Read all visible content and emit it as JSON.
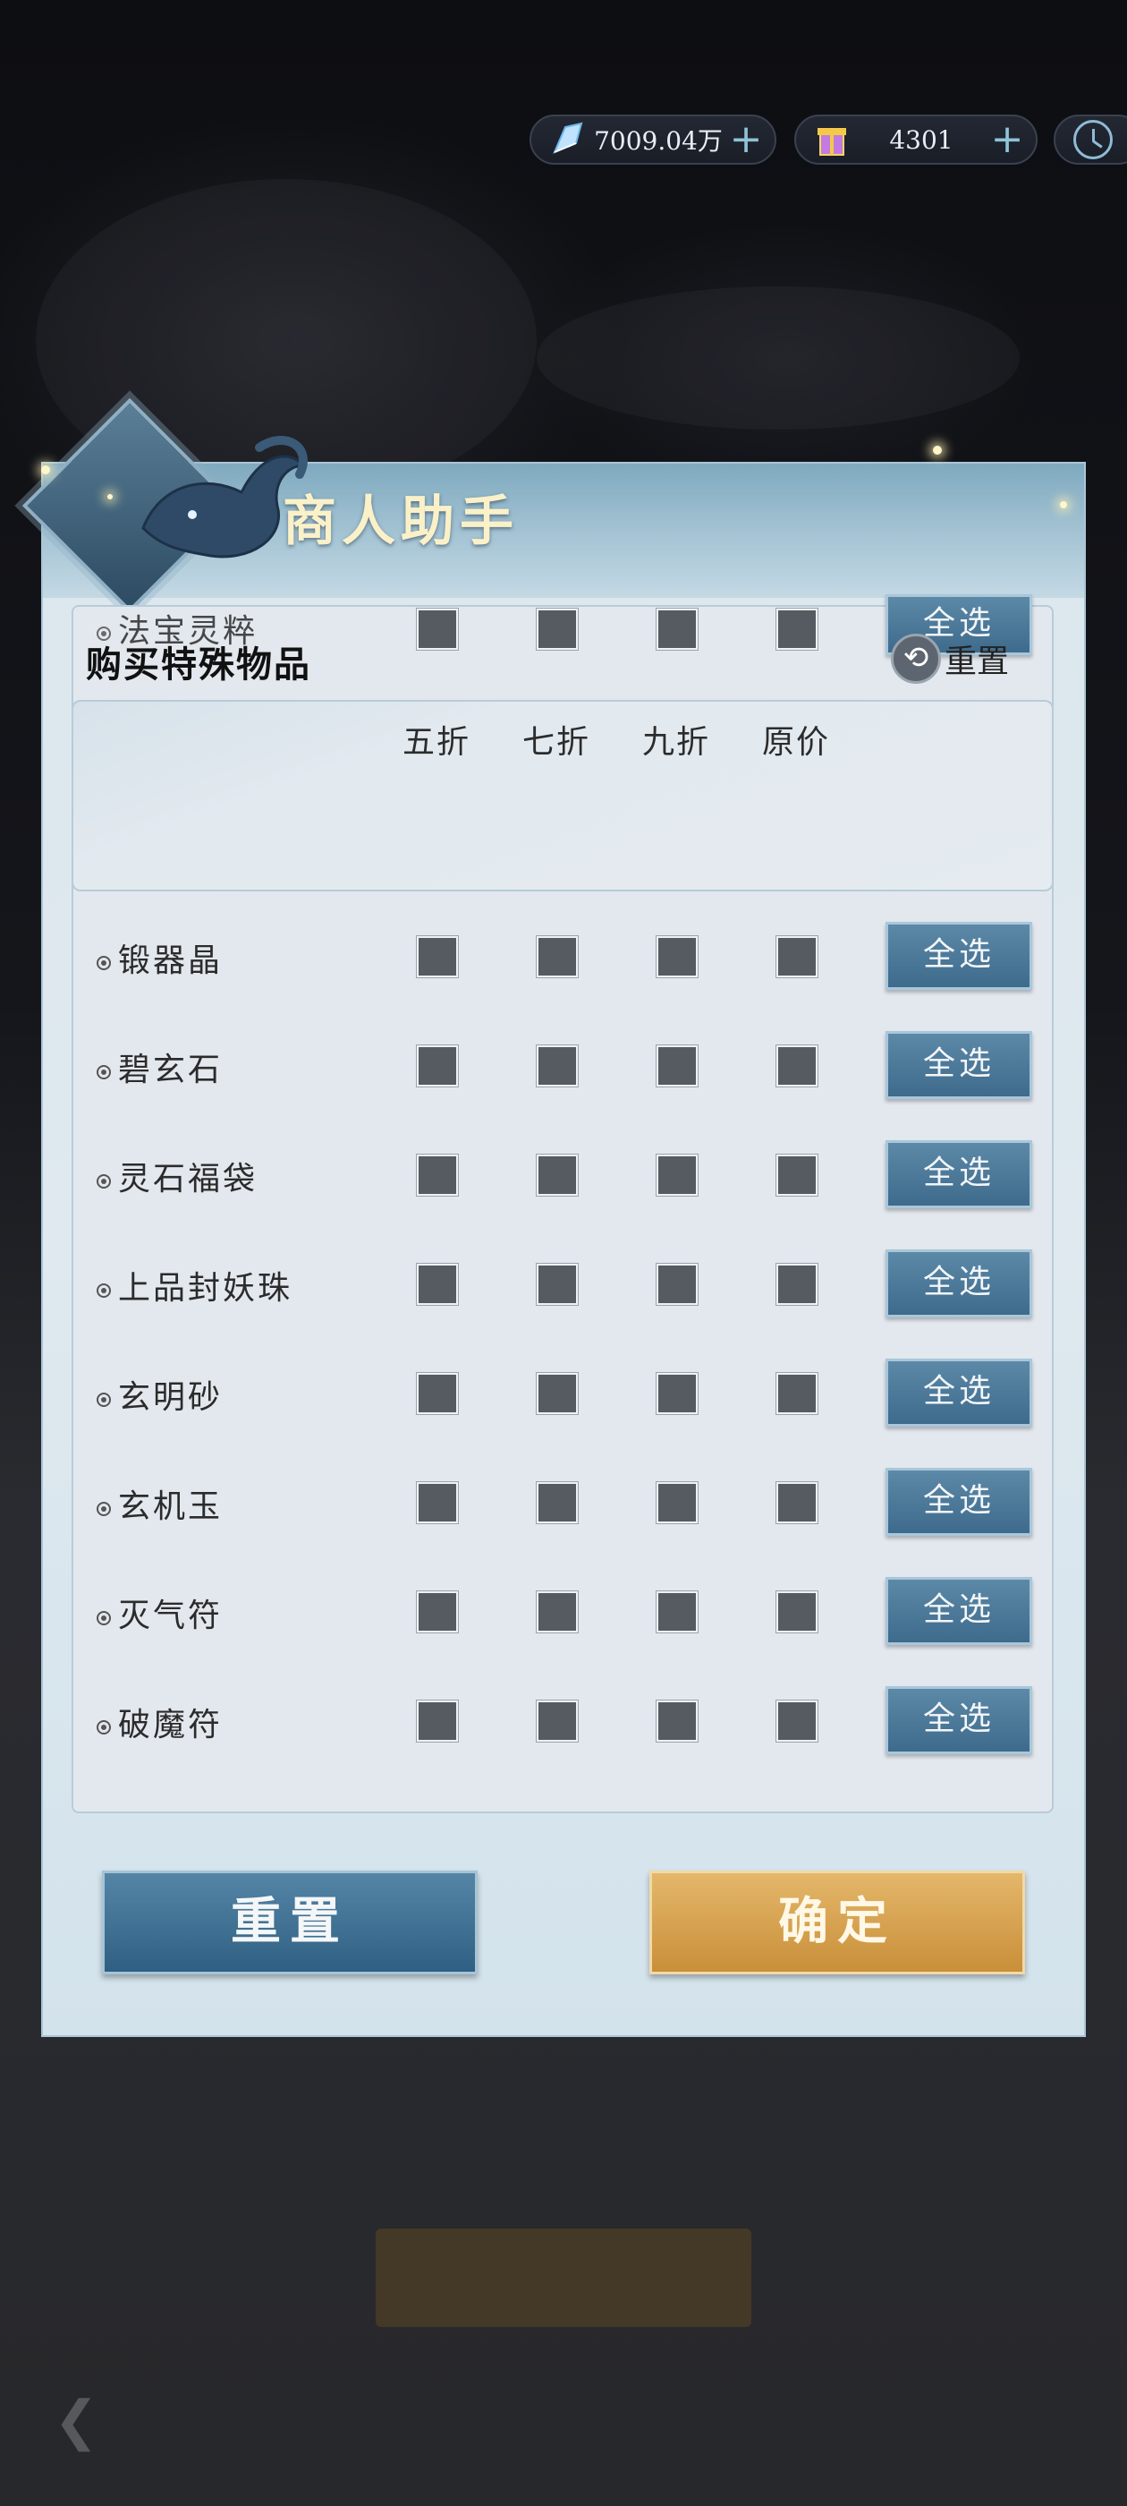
{
  "resources": {
    "spirit_stone": {
      "value": "7009.04万",
      "icon": "crystal-icon"
    },
    "gift_box": {
      "value": "4301",
      "icon": "gift-icon"
    },
    "clock_icon": "clock-icon"
  },
  "dialog": {
    "title": "商人助手",
    "section_title": "购买特殊物品",
    "reset_small_label": "重置",
    "columns": [
      "五折",
      "七折",
      "九折",
      "原价"
    ],
    "partial_row": {
      "name": "法宝灵粹",
      "select_all": "全选"
    },
    "rows": [
      {
        "name": "锻器晶",
        "select_all": "全选"
      },
      {
        "name": "碧玄石",
        "select_all": "全选"
      },
      {
        "name": "灵石福袋",
        "select_all": "全选"
      },
      {
        "name": "上品封妖珠",
        "select_all": "全选"
      },
      {
        "name": "玄明砂",
        "select_all": "全选"
      },
      {
        "name": "玄机玉",
        "select_all": "全选"
      },
      {
        "name": "灭气符",
        "select_all": "全选"
      },
      {
        "name": "破魔符",
        "select_all": "全选"
      }
    ],
    "reset_button": "重置",
    "confirm_button": "确定"
  }
}
